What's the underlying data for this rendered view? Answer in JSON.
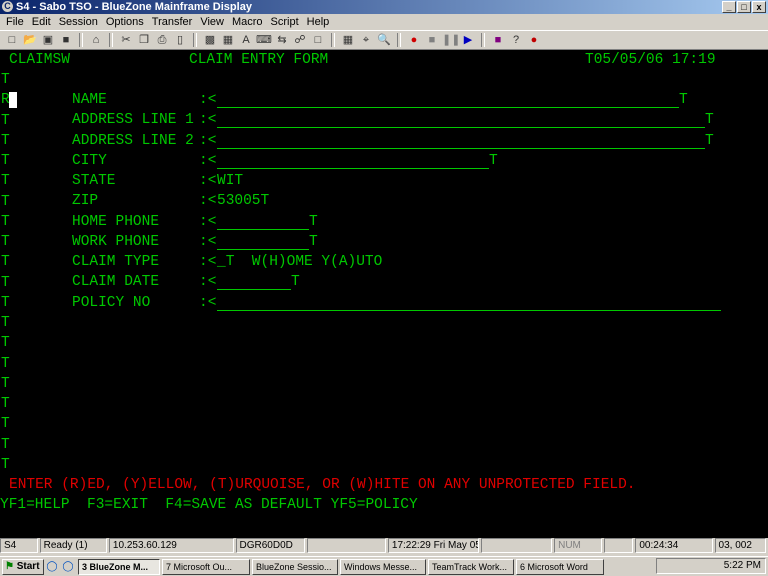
{
  "window": {
    "title": "S4 - Sabo TSO - BlueZone Mainframe Display",
    "buttons": [
      "_",
      "□",
      "x"
    ]
  },
  "menu": [
    "File",
    "Edit",
    "Session",
    "Options",
    "Transfer",
    "View",
    "Macro",
    "Script",
    "Help"
  ],
  "toolbar_icons": [
    "new-icon",
    "open-icon",
    "folder-icon",
    "save-icon",
    "home-icon",
    "cut-icon",
    "copy-icon",
    "print-icon",
    "paste-icon",
    "screen-icon",
    "capture-icon",
    "font-icon",
    "keyboard-icon",
    "transfer-icon",
    "connect-icon",
    "clipboard-icon",
    "macro-icon",
    "find-icon",
    "zoom-icon",
    "record-icon",
    "stop-icon",
    "pause-icon",
    "play-icon",
    "book-icon",
    "help-icon",
    "apple-icon"
  ],
  "terminal": {
    "header_left": "CLAIMSW",
    "header_title": "CLAIM ENTRY FORM",
    "header_right": "T05/05/06 17:19",
    "fields": [
      {
        "label": "NAME",
        "sep": ":<",
        "value": "",
        "end": "T"
      },
      {
        "label": "ADDRESS LINE 1",
        "sep": ":<",
        "value": "",
        "end": "T"
      },
      {
        "label": "ADDRESS LINE 2",
        "sep": ":<",
        "value": "",
        "end": "T"
      },
      {
        "label": "CITY",
        "sep": ":<",
        "value": "",
        "end": "T"
      },
      {
        "label": "STATE",
        "sep": ":<",
        "value": "WIT",
        "end": ""
      },
      {
        "label": "ZIP",
        "sep": ":<",
        "value": "53005T",
        "end": ""
      },
      {
        "label": "HOME PHONE",
        "sep": ":<",
        "value": "",
        "end": "T"
      },
      {
        "label": "WORK PHONE",
        "sep": ":<",
        "value": "",
        "end": "T"
      },
      {
        "label": "CLAIM TYPE",
        "sep": ":<",
        "value": "_T  W(H)OME Y(A)UTO",
        "end": ""
      },
      {
        "label": "CLAIM DATE",
        "sep": ":<",
        "value": "",
        "end": "T"
      },
      {
        "label": "POLICY NO",
        "sep": ":<",
        "value": "",
        "end": ""
      }
    ],
    "left_markers": [
      "T",
      "R",
      "T",
      "T",
      "T",
      "T",
      "T",
      "T",
      "T",
      "T",
      "T",
      "T",
      "T",
      "T",
      "T",
      "T",
      "T",
      "T",
      "T",
      "T"
    ],
    "message": "ENTER (R)ED, (Y)ELLOW, (T)URQUOISE, OR (W)HITE ON ANY UNPROTECTED FIELD.",
    "pf_keys": "YF1=HELP  F3=EXIT  F4=SAVE AS DEFAULT YF5=POLICY"
  },
  "statusbar": [
    "S4",
    "Ready (1)",
    "10.253.60.129",
    "DGR60D0D",
    "",
    "17:22:29  Fri May 05",
    "",
    "NUM",
    "",
    "00:24:34",
    "03, 002"
  ],
  "taskbar": {
    "start": "Start",
    "tasks": [
      "3 BlueZone M...",
      "7 Microsoft Ou...",
      "BlueZone Sessio...",
      "Windows Messe...",
      "TeamTrack Work...",
      "6 Microsoft Word"
    ],
    "clock": "5:22 PM"
  },
  "colors": {
    "terminal_bg": "#000000",
    "terminal_green": "#00c800",
    "terminal_red": "#e00000"
  }
}
